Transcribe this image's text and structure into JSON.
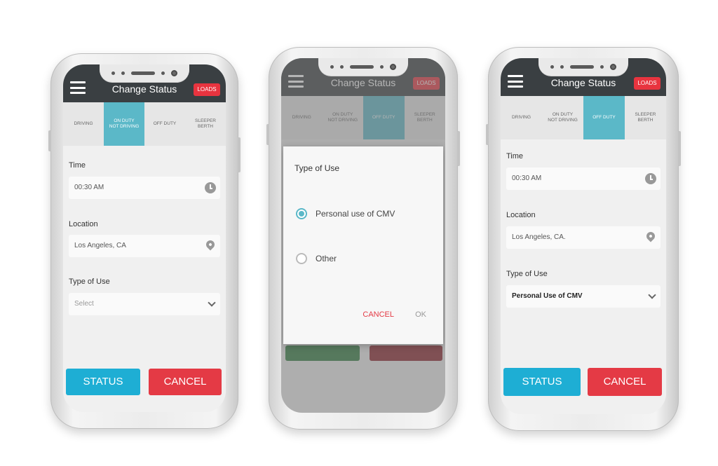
{
  "colors": {
    "topbar": "#3a3f42",
    "accent_teal": "#5bb8c8",
    "status_blue": "#1eaed4",
    "cancel_red": "#e43a45"
  },
  "header": {
    "menu_icon": "hamburger-icon",
    "title": "Change Status",
    "loads_label": "LOADS"
  },
  "tabs": [
    {
      "label": "DRIVING"
    },
    {
      "label": "ON DUTY\nNOT DRIVING"
    },
    {
      "label": "OFF DUTY"
    },
    {
      "label": "SLEEPER\nBERTH"
    }
  ],
  "form": {
    "time_label": "Time",
    "time_value": "00:30 AM",
    "location_label": "Location",
    "type_label": "Type of Use"
  },
  "screen1": {
    "location_value": "Los Angeles, CA",
    "type_placeholder": "Select"
  },
  "screen3": {
    "location_value": "Los Angeles, CA.",
    "type_value": "Personal Use of CMV"
  },
  "actions": {
    "status_label": "STATUS",
    "cancel_label": "CANCEL"
  },
  "dialog": {
    "title": "Type of Use",
    "options": [
      {
        "label": "Personal use of CMV",
        "selected": true
      },
      {
        "label": "Other",
        "selected": false
      }
    ],
    "cancel_label": "CANCEL",
    "ok_label": "OK"
  }
}
